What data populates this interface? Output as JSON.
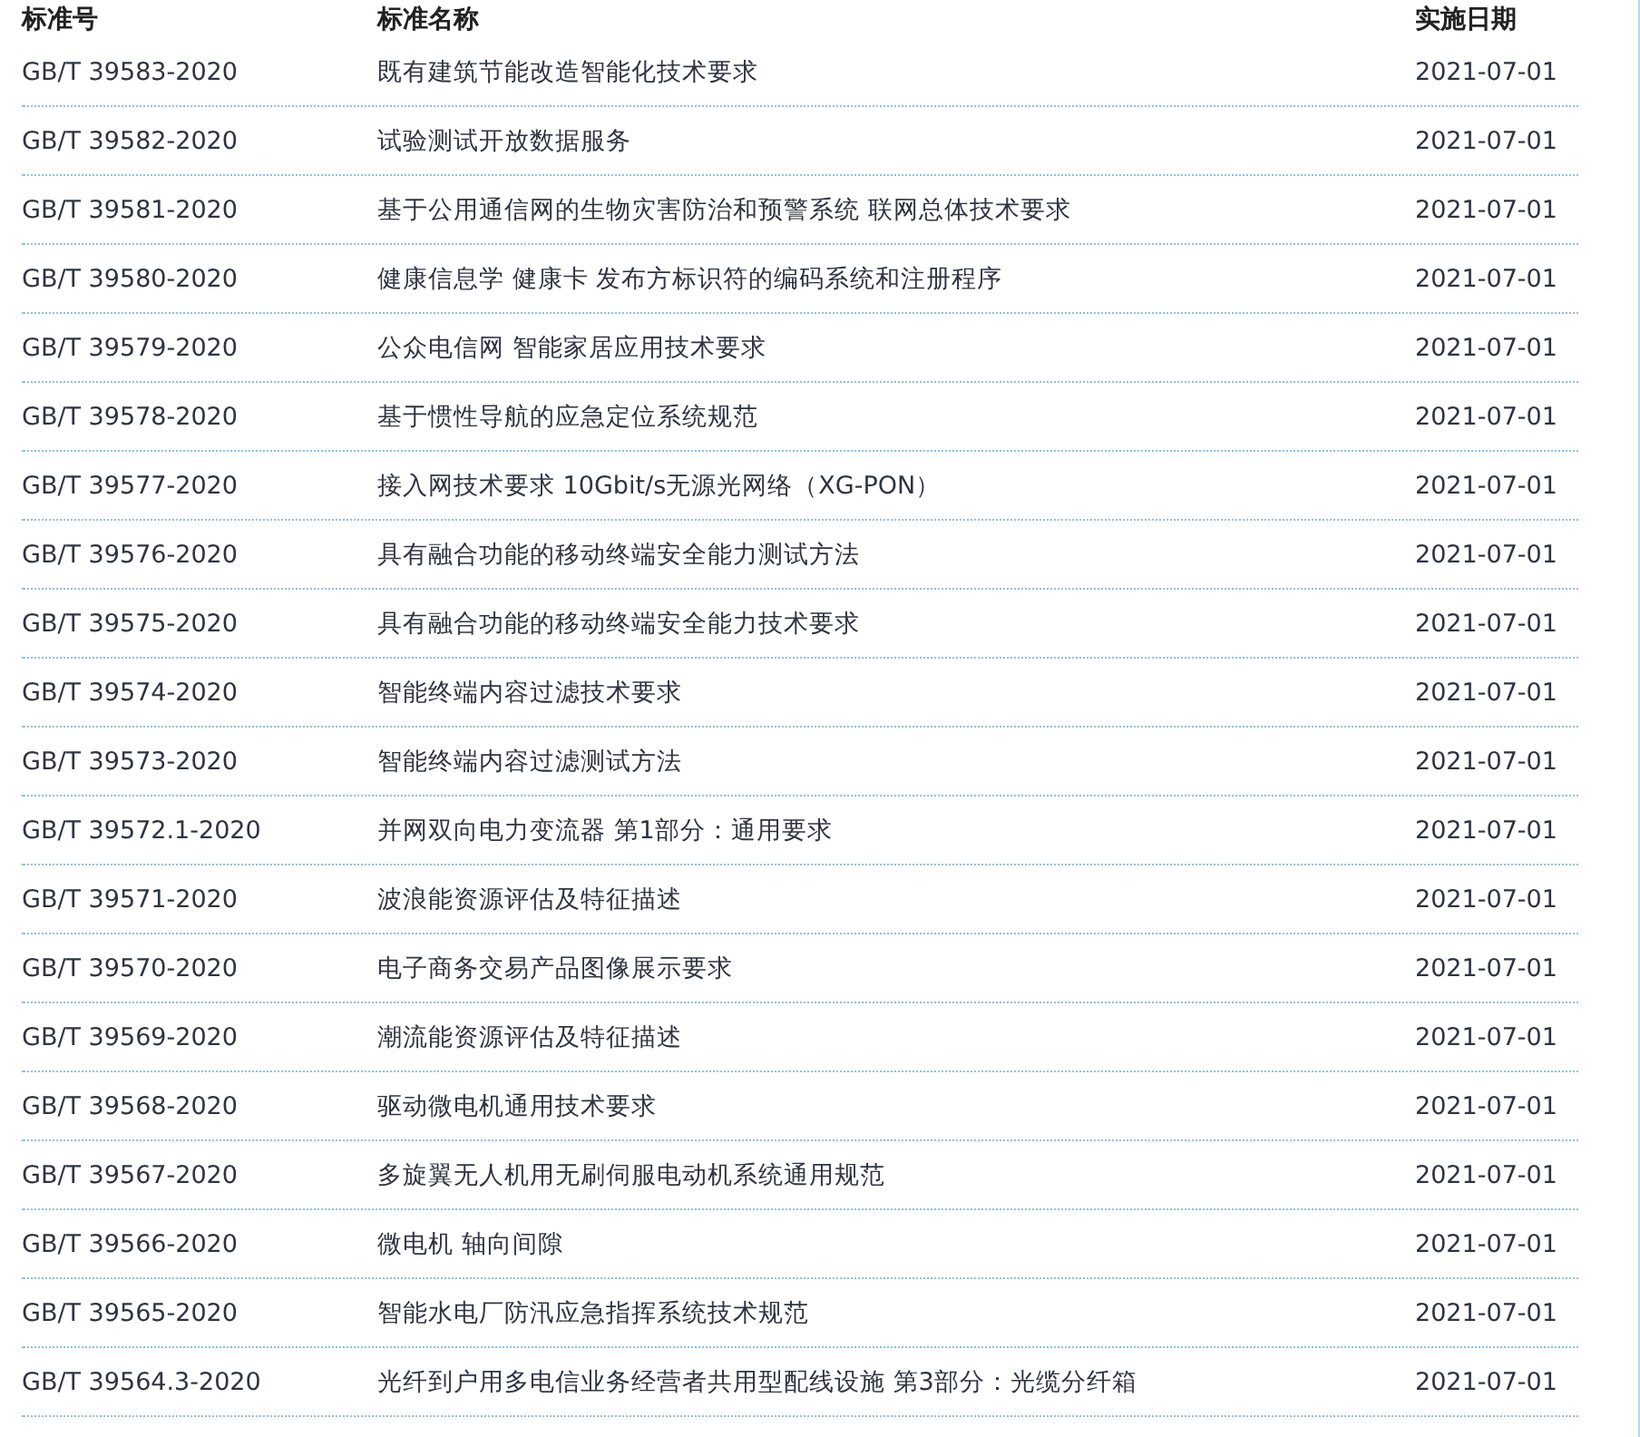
{
  "table": {
    "columns": [
      "标准号",
      "标准名称",
      "实施日期"
    ],
    "rows": [
      {
        "number": "GB/T 39583-2020",
        "name": "既有建筑节能改造智能化技术要求",
        "date": "2021-07-01"
      },
      {
        "number": "GB/T 39582-2020",
        "name": "试验测试开放数据服务",
        "date": "2021-07-01"
      },
      {
        "number": "GB/T 39581-2020",
        "name": "基于公用通信网的生物灾害防治和预警系统 联网总体技术要求",
        "date": "2021-07-01"
      },
      {
        "number": "GB/T 39580-2020",
        "name": "健康信息学 健康卡 发布方标识符的编码系统和注册程序",
        "date": "2021-07-01"
      },
      {
        "number": "GB/T 39579-2020",
        "name": "公众电信网 智能家居应用技术要求",
        "date": "2021-07-01"
      },
      {
        "number": "GB/T 39578-2020",
        "name": "基于惯性导航的应急定位系统规范",
        "date": "2021-07-01"
      },
      {
        "number": "GB/T 39577-2020",
        "name": "接入网技术要求 10Gbit/s无源光网络（XG-PON）",
        "date": "2021-07-01"
      },
      {
        "number": "GB/T 39576-2020",
        "name": "具有融合功能的移动终端安全能力测试方法",
        "date": "2021-07-01"
      },
      {
        "number": "GB/T 39575-2020",
        "name": "具有融合功能的移动终端安全能力技术要求",
        "date": "2021-07-01"
      },
      {
        "number": "GB/T 39574-2020",
        "name": "智能终端内容过滤技术要求",
        "date": "2021-07-01"
      },
      {
        "number": "GB/T 39573-2020",
        "name": "智能终端内容过滤测试方法",
        "date": "2021-07-01"
      },
      {
        "number": "GB/T 39572.1-2020",
        "name": "并网双向电力变流器 第1部分：通用要求",
        "date": "2021-07-01"
      },
      {
        "number": "GB/T 39571-2020",
        "name": "波浪能资源评估及特征描述",
        "date": "2021-07-01"
      },
      {
        "number": "GB/T 39570-2020",
        "name": "电子商务交易产品图像展示要求",
        "date": "2021-07-01"
      },
      {
        "number": "GB/T 39569-2020",
        "name": "潮流能资源评估及特征描述",
        "date": "2021-07-01"
      },
      {
        "number": "GB/T 39568-2020",
        "name": "驱动微电机通用技术要求",
        "date": "2021-07-01"
      },
      {
        "number": "GB/T 39567-2020",
        "name": "多旋翼无人机用无刷伺服电动机系统通用规范",
        "date": "2021-07-01"
      },
      {
        "number": "GB/T 39566-2020",
        "name": "微电机 轴向间隙",
        "date": "2021-07-01"
      },
      {
        "number": "GB/T 39565-2020",
        "name": "智能水电厂防汛应急指挥系统技术规范",
        "date": "2021-07-01"
      },
      {
        "number": "GB/T 39564.3-2020",
        "name": "光纤到户用多电信业务经营者共用型配线设施 第3部分：光缆分纤箱",
        "date": "2021-07-01"
      }
    ]
  }
}
